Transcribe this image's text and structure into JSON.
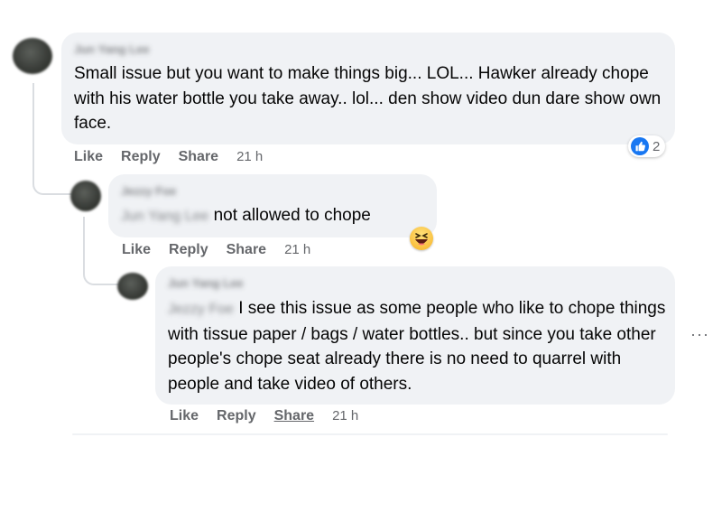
{
  "comments": [
    {
      "author": "Jun Yang Lee",
      "text": "Small issue but you want to make things big... LOL... Hawker already chope with his water bottle you take away.. lol... den show video dun dare show own face.",
      "actions": {
        "like": "Like",
        "reply": "Reply",
        "share": "Share",
        "time": "21 h"
      },
      "reaction_count": "2"
    },
    {
      "author": "Jezzy Foe",
      "mention": "Jun Yang Lee",
      "text": "not allowed to chope",
      "actions": {
        "like": "Like",
        "reply": "Reply",
        "share": "Share",
        "time": "21 h"
      }
    },
    {
      "author": "Jun Yang Lee",
      "mention": "Jezzy Foe",
      "text": "I see this issue as some people who like to chope things with tissue paper / bags / water bottles.. but since you take other people's chope seat already there is no need to quarrel with people and take video of others.",
      "actions": {
        "like": "Like",
        "reply": "Reply",
        "share": "Share",
        "time": "21 h"
      }
    }
  ],
  "more_label": "···",
  "colors": {
    "like_blue": "#1877f2",
    "bubble": "#f0f2f5",
    "meta_gray": "#65676b"
  }
}
